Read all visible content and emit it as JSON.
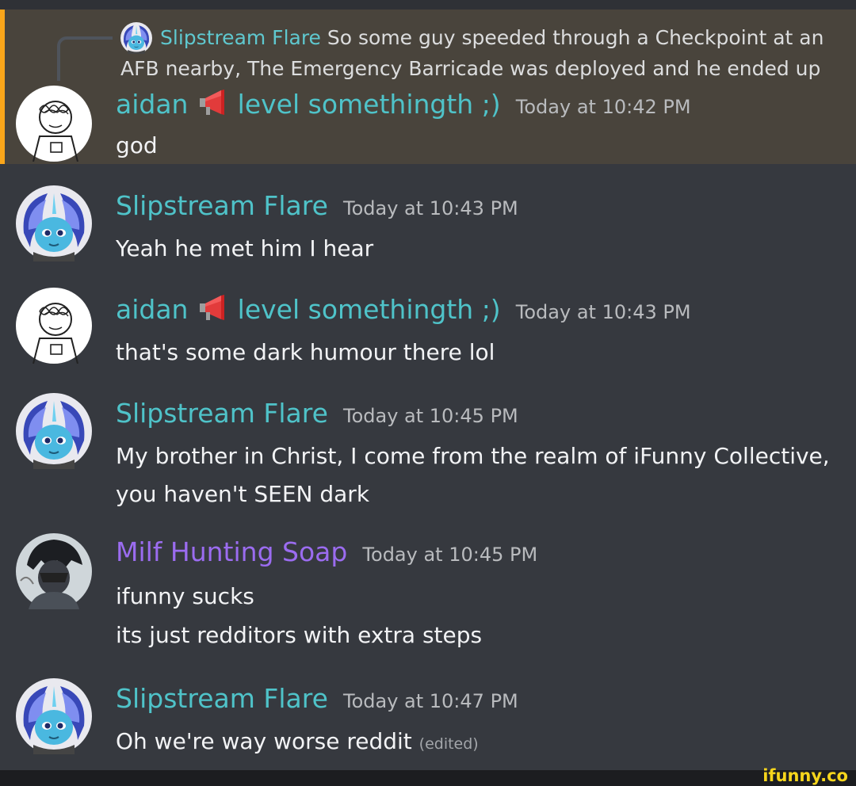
{
  "reply": {
    "author": "Slipstream Flare",
    "text_line1": " So some guy speeded through a Checkpoint at an",
    "text_line2": "AFB nearby, The Emergency Barricade was deployed and he ended up"
  },
  "messages": [
    {
      "author": "aidan",
      "tag": "level somethingth ;)",
      "timestamp": "Today at 10:42 PM",
      "lines": [
        "god"
      ],
      "author_color": "#4fc3c9",
      "avatar": "sketch-avatar",
      "highlighted": true
    },
    {
      "author": "Slipstream Flare",
      "timestamp": "Today at 10:43 PM",
      "lines": [
        "Yeah he met him I hear"
      ],
      "author_color": "#4fc3c9",
      "avatar": "pony-avatar"
    },
    {
      "author": "aidan",
      "tag": "level somethingth ;)",
      "timestamp": "Today at 10:43 PM",
      "lines": [
        "that's some dark humour there lol"
      ],
      "author_color": "#4fc3c9",
      "avatar": "sketch-avatar"
    },
    {
      "author": "Slipstream Flare",
      "timestamp": "Today at 10:45 PM",
      "lines": [
        "My brother in Christ, I come from the realm of iFunny Collective,",
        "you haven't SEEN dark"
      ],
      "author_color": "#4fc3c9",
      "avatar": "pony-avatar"
    },
    {
      "author": "Milf Hunting Soap",
      "timestamp": "Today at 10:45 PM",
      "lines": [
        "ifunny sucks",
        "its just redditors with extra steps"
      ],
      "author_color": "#9b6cf0",
      "avatar": "soldier-avatar"
    },
    {
      "author": "Slipstream Flare",
      "timestamp": "Today at 10:47 PM",
      "lines": [
        "Oh we're way worse reddit"
      ],
      "edited": "(edited)",
      "author_color": "#4fc3c9",
      "avatar": "pony-avatar"
    }
  ],
  "watermark": "ifunny.co",
  "colors": {
    "background": "#36393f",
    "highlight": "#49443c",
    "highlight_bar": "#faa61a"
  }
}
